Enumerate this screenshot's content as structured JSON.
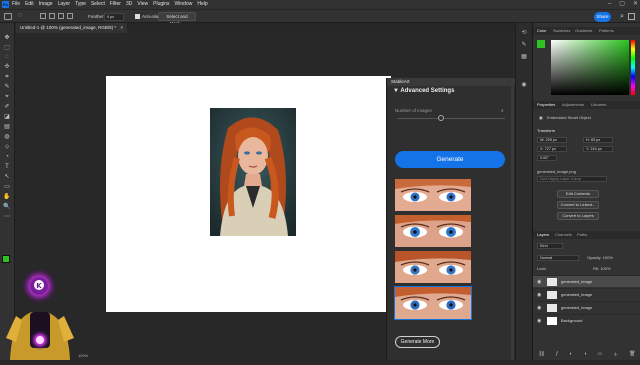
{
  "menu": {
    "logo": "Ps",
    "items": [
      "File",
      "Edit",
      "Image",
      "Layer",
      "Type",
      "Select",
      "Filter",
      "3D",
      "View",
      "Plugins",
      "Window",
      "Help"
    ],
    "window_controls": [
      "–",
      "▢",
      "✕"
    ]
  },
  "options_bar": {
    "feather_label": "Feather:",
    "feather_value": "0 px",
    "anti_alias": "Anti-alias",
    "select_mask": "Select and Mask...",
    "share": "Share"
  },
  "document_tab": {
    "title": "Untitled-1 @ 100% (generated_image, RGB/8) *",
    "close": "×"
  },
  "tools": [
    "✥",
    "⬚",
    "◌",
    "✣",
    "⌗",
    "✎",
    "⌖",
    "✐",
    "◪",
    "▤",
    "◍",
    "⬦",
    "◔",
    "T",
    "↖",
    "▭",
    "✋",
    "🔍",
    "⋯"
  ],
  "plugin_panel": {
    "title": "StableArt",
    "section": "Advanced Settings",
    "section_arrow": "▼",
    "num_images_label": "Number of images",
    "num_images_mark": "4",
    "generate": "Generate",
    "generate_more": "Generate More",
    "selected_thumbnail": 4
  },
  "right_panels": {
    "color_tabs": [
      "Color",
      "Swatches",
      "Gradients",
      "Patterns"
    ],
    "props_tabs": [
      "Properties",
      "Adjustments",
      "Libraries"
    ],
    "smart_object": "Embedded Smart Object",
    "transform": "Transform",
    "w": "W: 209 px",
    "h": "H: 83 px",
    "x": "X: 727 px",
    "y": "Y: 244 px",
    "angle": "0.00°",
    "file": "generated_image.png",
    "layer_comp": "Don't Apply Layer Comp",
    "btn_edit": "Edit Contents",
    "btn_linked": "Convert to Linked...",
    "btn_layers": "Convert to Layers",
    "layers_tabs": [
      "Layers",
      "Channels",
      "Paths"
    ],
    "kind": "Kind",
    "blend": "Normal",
    "opacity": "Opacity: 100%",
    "lock": "Lock:",
    "fill": "Fill: 100%",
    "layers": [
      "generated_image",
      "generated_image",
      "generated_image",
      "Background"
    ]
  },
  "status": {
    "zoom": "100%",
    "doc": "5.6M/1"
  },
  "colors": {
    "accent": "#1473e6",
    "foreground": "#2dc21f",
    "background": "#ffffff"
  }
}
